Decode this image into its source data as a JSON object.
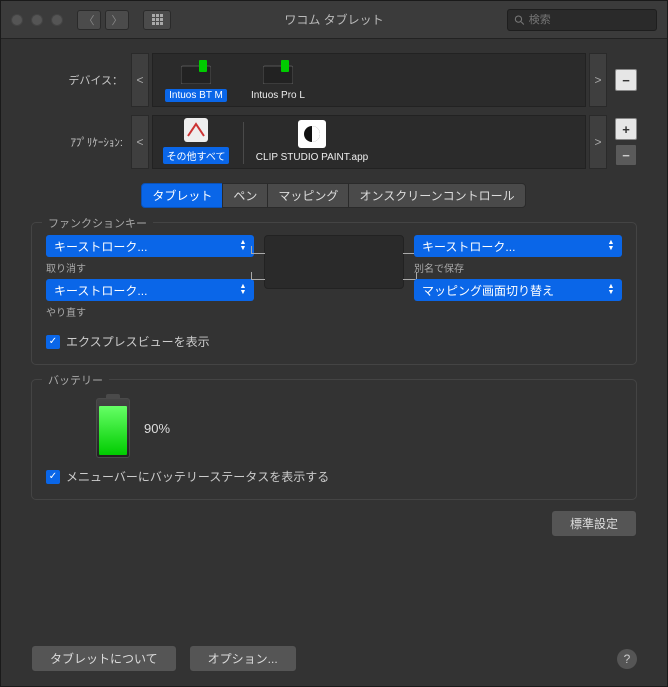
{
  "window": {
    "title": "ワコム タブレット",
    "search_placeholder": "検索"
  },
  "selector": {
    "device_label": "デバイス：",
    "app_label": "ｱﾌﾟﾘｹｰｼｮﾝ:",
    "prev": "<",
    "next": ">",
    "minus": "−",
    "plus": "+",
    "devices": [
      {
        "name": "Intuos BT M",
        "selected": true
      },
      {
        "name": "Intuos Pro L",
        "selected": false
      }
    ],
    "apps": [
      {
        "name": "その他すべて",
        "selected": true
      },
      {
        "name": "CLIP STUDIO PAINT.app",
        "selected": false
      }
    ]
  },
  "tabs": {
    "items": [
      "タブレット",
      "ペン",
      "マッピング",
      "オンスクリーンコントロール"
    ],
    "active": 0
  },
  "function_keys": {
    "group_title": "ファンクションキー",
    "left_top": {
      "value": "キーストローク...",
      "sub": "取り消す"
    },
    "left_bottom": {
      "value": "キーストローク...",
      "sub": "やり直す"
    },
    "right_top": {
      "value": "キーストローク...",
      "sub": "別名で保存"
    },
    "right_bottom": {
      "value": "マッピング画面切り替え",
      "sub": ""
    },
    "express_view_label": "エクスプレスビューを表示"
  },
  "battery": {
    "group_title": "バッテリー",
    "percent": "90%",
    "menu_label": "メニューバーにバッテリーステータスを表示する"
  },
  "buttons": {
    "defaults": "標準設定",
    "about": "タブレットについて",
    "options": "オプション..."
  }
}
